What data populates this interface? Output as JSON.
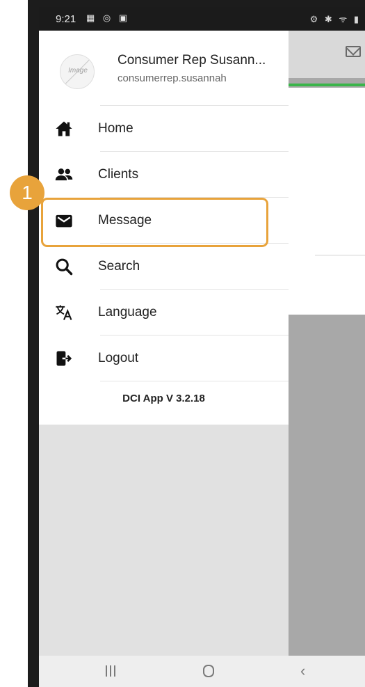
{
  "status_bar": {
    "time": "9:21",
    "left_icons": "▦ ◎ ▣",
    "right_icons": "⚙ ✱ ᯤ ▮"
  },
  "drawer": {
    "profile": {
      "avatar_text": "Image",
      "name": "Consumer Rep Susann...",
      "username": "consumerrep.susannah"
    },
    "menu": [
      {
        "label": "Home",
        "icon": "home-icon"
      },
      {
        "label": "Clients",
        "icon": "users-icon"
      },
      {
        "label": "Message",
        "icon": "envelope-icon"
      },
      {
        "label": "Search",
        "icon": "search-icon"
      },
      {
        "label": "Language",
        "icon": "translate-icon"
      },
      {
        "label": "Logout",
        "icon": "logout-icon"
      }
    ],
    "version": "DCI App V 3.2.18"
  },
  "annotation": {
    "step_number": "1",
    "highlighted_item": "Message",
    "color": "#e8a33b"
  },
  "background_app": {
    "accent_color": "#3ab54a",
    "icon": "mail-icon"
  },
  "nav_bar": {
    "recents": "recents-icon",
    "home": "home-button-icon",
    "back": "‹"
  }
}
